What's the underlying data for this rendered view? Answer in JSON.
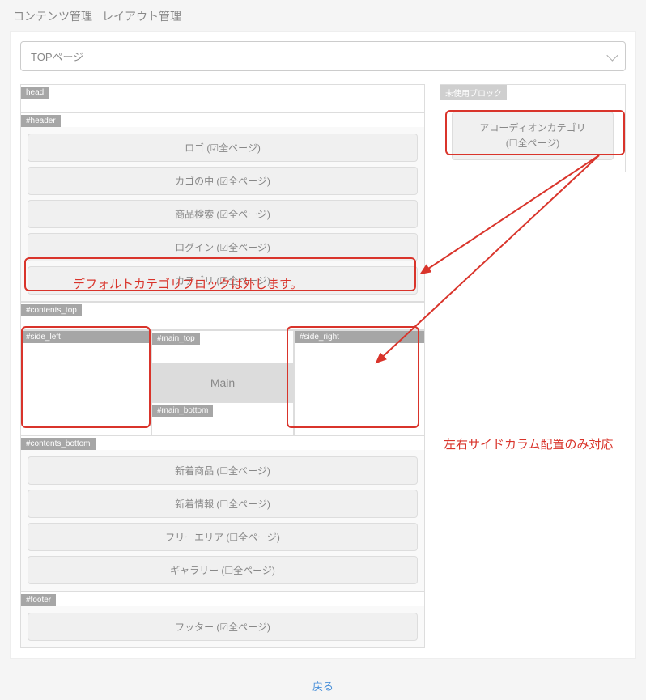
{
  "header": {
    "section": "コンテンツ管理",
    "subsection": "レイアウト管理"
  },
  "page_select": {
    "value": "TOPページ"
  },
  "regions": {
    "head": {
      "tag": "head"
    },
    "header": {
      "tag": "#header",
      "blocks": [
        {
          "label": "ロゴ",
          "all_pages_label": "全ページ",
          "checked": true
        },
        {
          "label": "カゴの中",
          "all_pages_label": "全ページ",
          "checked": true
        },
        {
          "label": "商品検索",
          "all_pages_label": "全ページ",
          "checked": true
        },
        {
          "label": "ログイン",
          "all_pages_label": "全ページ",
          "checked": true
        },
        {
          "label": "カテゴリ",
          "all_pages_label": "全ページ",
          "checked": true
        }
      ]
    },
    "contents_top": {
      "tag": "#contents_top"
    },
    "side_left": {
      "tag": "#side_left"
    },
    "main_top": {
      "tag": "#main_top"
    },
    "main": {
      "label": "Main"
    },
    "main_bottom": {
      "tag": "#main_bottom"
    },
    "side_right": {
      "tag": "#side_right"
    },
    "contents_bottom": {
      "tag": "#contents_bottom",
      "blocks": [
        {
          "label": "新着商品",
          "all_pages_label": "全ページ",
          "checked": false
        },
        {
          "label": "新着情報",
          "all_pages_label": "全ページ",
          "checked": false
        },
        {
          "label": "フリーエリア",
          "all_pages_label": "全ページ",
          "checked": false
        },
        {
          "label": "ギャラリー",
          "all_pages_label": "全ページ",
          "checked": false
        }
      ]
    },
    "footer": {
      "tag": "#footer",
      "blocks": [
        {
          "label": "フッター",
          "all_pages_label": "全ページ",
          "checked": true
        }
      ]
    }
  },
  "unused_panel": {
    "tag": "未使用ブロック",
    "block": {
      "line1": "アコーディオンカテゴリ",
      "line2_label": "全ページ",
      "checked": false
    }
  },
  "back_link": {
    "label": "戻る"
  },
  "annotations": {
    "note1": "デフォルトカテゴリブロックは外します。",
    "note2": "左右サイドカラム配置のみ対応"
  }
}
